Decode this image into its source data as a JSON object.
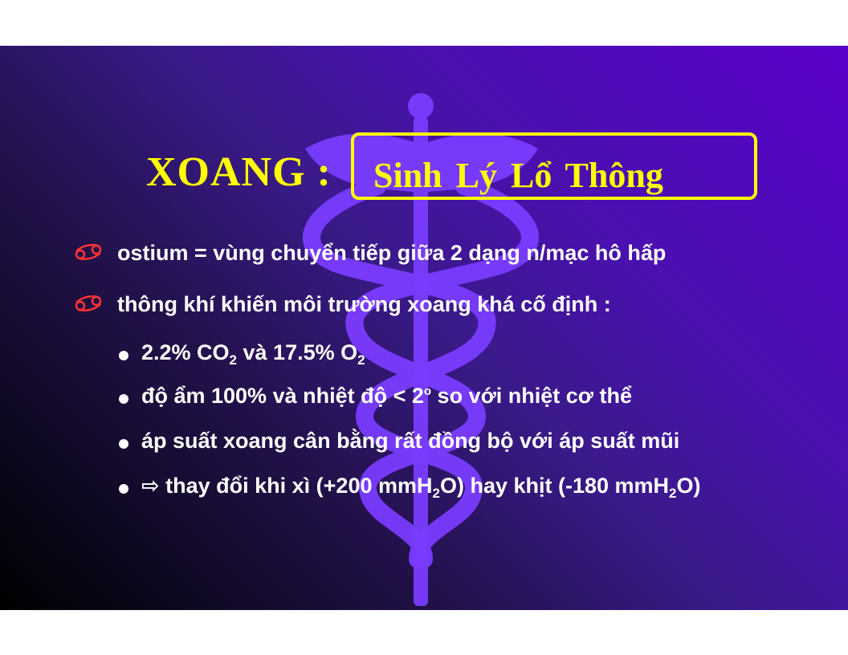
{
  "title": {
    "main": "XOANG  :",
    "boxed": "Sinh  Lý  Lổ  Thông"
  },
  "bullets": [
    {
      "text": "ostium = vùng chuyển tiếp giữa 2 dạng n/mạc hô hấp"
    },
    {
      "text": "thông khí khiến môi trường xoang khá cố định :"
    }
  ],
  "sub_bullets": {
    "gas": {
      "p1": "2.2% CO",
      "co2_sub": "2",
      "p2": " và 17.5% O",
      "o2_sub": "2"
    },
    "humidity": {
      "p1": "độ ẩm 100% và nhiệt độ < 2",
      "deg": "o",
      "p2": " so với nhiệt cơ thể"
    },
    "pressure": {
      "text": "áp suất xoang cân bằng rất đồng bộ với áp suất mũi"
    },
    "change": {
      "arrow": "⇨",
      "p1": " thay đổi khi xì (+200 mmH",
      "sub1": "2",
      "p2": "O) hay khịt (-180 mmH",
      "sub2": "2",
      "p3": "O)"
    }
  },
  "colors": {
    "title": "#ffff00",
    "body_text": "#ffffff",
    "emblem": "#7a3cff",
    "bullet_icon": "#ff3333"
  },
  "icons": {
    "main_bullet": "cancer-sign-icon",
    "emblem": "caduceus-icon"
  }
}
